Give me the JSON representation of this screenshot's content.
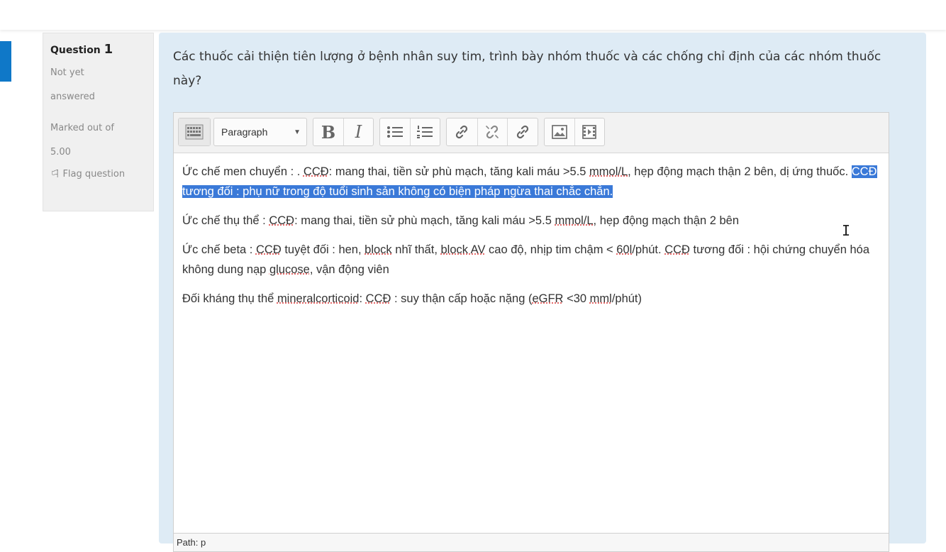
{
  "question": {
    "label": "Question",
    "number": "1",
    "state_line1": "Not yet",
    "state_line2": "answered",
    "mark_line1": "Marked out of",
    "mark_line2": "5.00",
    "flag_label": "Flag question",
    "text": "Các thuốc cải thiện tiên lượng ở bệnh nhân suy tim, trình bày nhóm thuốc và các chống chỉ định của các nhóm thuốc này?"
  },
  "toolbar": {
    "kitchen_icon": "keyboard-icon",
    "paragraph_label": "Paragraph",
    "bold_label": "B",
    "italic_label": "I"
  },
  "editor": {
    "p1_a": "Ức chế men chuyển : . ",
    "p1_b": "CCĐ",
    "p1_c": ": mang thai, tiền sử phù mạch, tăng kali máu >5.5 ",
    "p1_d": "mmol/L",
    "p1_e": ", hẹp động mạch thận 2 bên, dị ứng thuốc. ",
    "p1_selected": "CCĐ tương đối : phụ nữ trong độ tuổi sinh sản không có biện pháp ngừa thai chắc chắn.",
    "p2_a": "Ức chế thụ thể : ",
    "p2_b": "CCĐ",
    "p2_c": ": mang thai, tiền sử phù mạch, tăng kali máu >5.5 ",
    "p2_d": "mmol/L",
    "p2_e": ", hẹp động mạch thận 2 bên",
    "p3_a": "Ức chế beta : ",
    "p3_b": "CCĐ",
    "p3_c": " tuyệt đối : hen, ",
    "p3_d": "block",
    "p3_e": " nhĩ thất, ",
    "p3_f": "block AV",
    "p3_g": " cao độ, nhịp tim chậm < ",
    "p3_h": "60l",
    "p3_i": "/phút. ",
    "p3_j": "CCĐ",
    "p3_k": " tương đối : hội chứng chuyển hóa không dung nạp ",
    "p3_l": "glucose",
    "p3_m": ", vận động viên",
    "p4_a": "Đối kháng thụ thể ",
    "p4_b": "mineralcorticoid",
    "p4_c": ": ",
    "p4_d": "CCĐ",
    "p4_e": " : suy thận cấp hoặc nặng (",
    "p4_f": "eGFR",
    "p4_g": " <30 ",
    "p4_h": "mml",
    "p4_i": "/phút)",
    "path_label": "Path: p"
  }
}
